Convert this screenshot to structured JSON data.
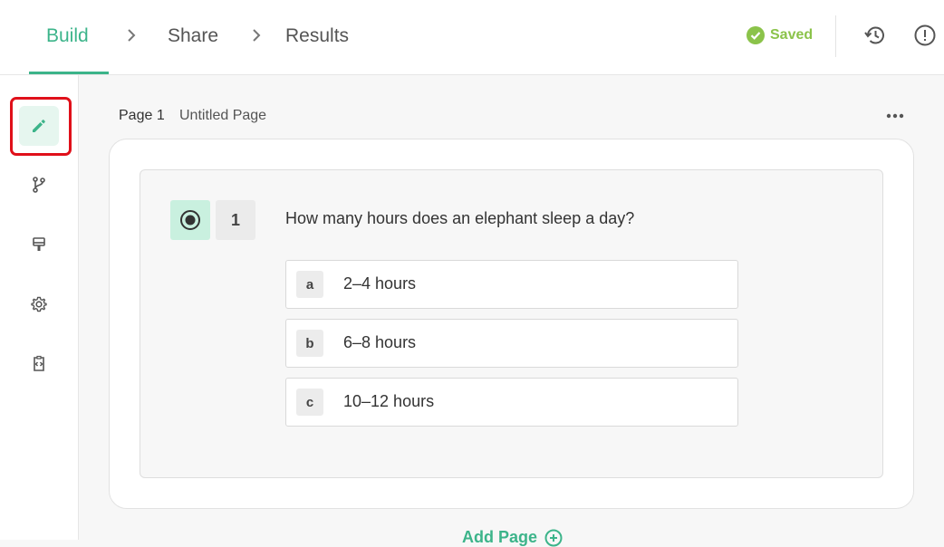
{
  "header": {
    "steps": [
      {
        "label": "Build",
        "active": true
      },
      {
        "label": "Share",
        "active": false
      },
      {
        "label": "Results",
        "active": false
      }
    ],
    "saved_label": "Saved",
    "accent_color": "#3cb48a",
    "saved_color": "#8bc34a"
  },
  "sidebar": {
    "items": [
      {
        "icon": "pencil-icon",
        "active": true
      },
      {
        "icon": "branch-icon",
        "active": false
      },
      {
        "icon": "paint-roller-icon",
        "active": false
      },
      {
        "icon": "gear-icon",
        "active": false
      },
      {
        "icon": "embed-code-icon",
        "active": false
      }
    ]
  },
  "page": {
    "label": "Page 1",
    "name": "Untitled Page"
  },
  "question": {
    "number": "1",
    "type_icon": "radio-button-icon",
    "text": "How many hours does an elephant sleep a day?",
    "options": [
      {
        "key": "a",
        "text": "2–4 hours"
      },
      {
        "key": "b",
        "text": "6–8 hours"
      },
      {
        "key": "c",
        "text": "10–12 hours"
      }
    ]
  },
  "footer": {
    "add_page_label": "Add Page"
  }
}
